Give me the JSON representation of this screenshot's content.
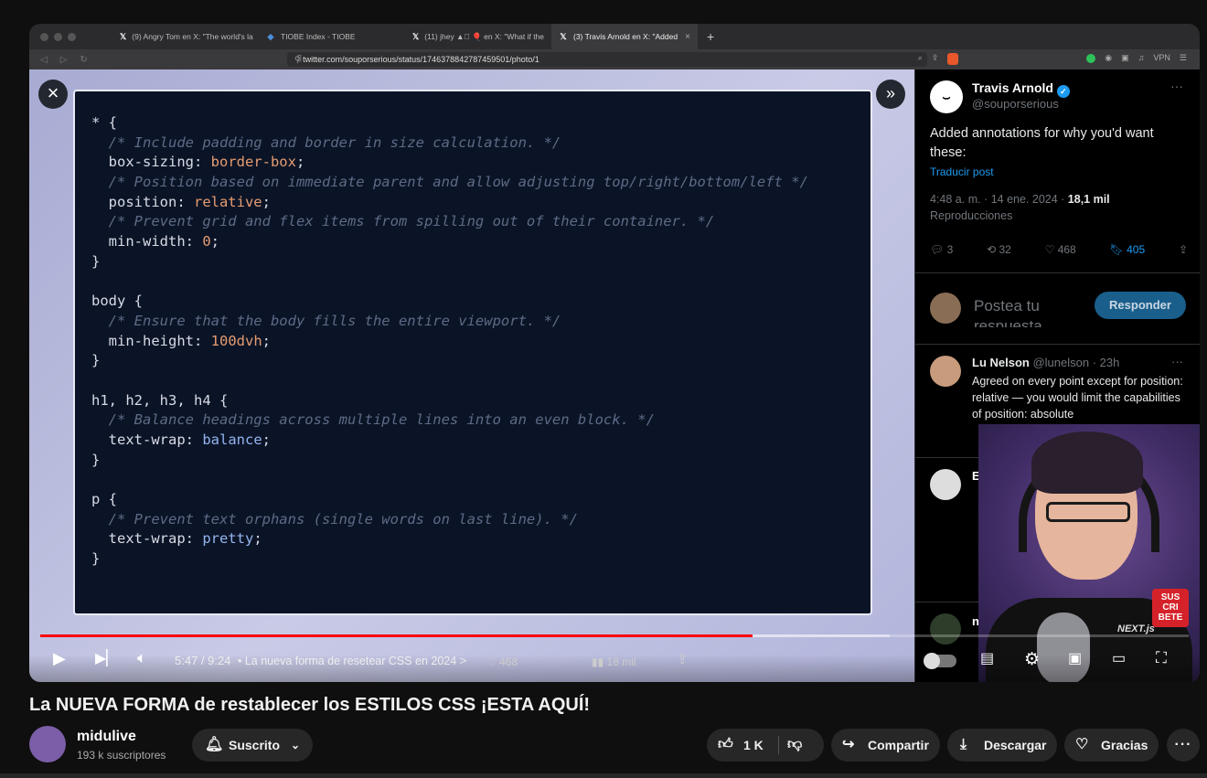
{
  "browser": {
    "tabs": [
      {
        "label": "(9) Angry Tom en X: \"The world's la",
        "icon": "x-logo"
      },
      {
        "label": "TIOBE Index - TIOBE",
        "icon": "tiobe-logo"
      },
      {
        "label": "(11) jhey ▲🏽 🎈 en X: \"What if the",
        "icon": "x-logo"
      },
      {
        "label": "(3) Travis Arnold en X: \"Added",
        "icon": "x-logo"
      }
    ],
    "url": "twitter.com/souporserious/status/1746378842787459501/photo/1",
    "vpn_label": "VPN"
  },
  "code_lines": [
    [
      {
        "t": "* {",
        "c": ""
      }
    ],
    [
      {
        "t": "  /* Include padding and border in size calculation. */",
        "c": "cm"
      }
    ],
    [
      {
        "t": "  box-sizing: ",
        "c": ""
      },
      {
        "t": "border-box",
        "c": "vl"
      },
      {
        "t": ";",
        "c": ""
      }
    ],
    [
      {
        "t": "  /* Position based on immediate parent and allow adjusting top/right/bottom/left */",
        "c": "cm"
      }
    ],
    [
      {
        "t": "  position: ",
        "c": ""
      },
      {
        "t": "relative",
        "c": "vl"
      },
      {
        "t": ";",
        "c": ""
      }
    ],
    [
      {
        "t": "  /* Prevent grid and flex items from spilling out of their container. */",
        "c": "cm"
      }
    ],
    [
      {
        "t": "  min-width: ",
        "c": ""
      },
      {
        "t": "0",
        "c": "vl"
      },
      {
        "t": ";",
        "c": ""
      }
    ],
    [
      {
        "t": "}",
        "c": ""
      }
    ],
    [
      {
        "t": "",
        "c": ""
      }
    ],
    [
      {
        "t": "body {",
        "c": ""
      }
    ],
    [
      {
        "t": "  /* Ensure that the body fills the entire viewport. */",
        "c": "cm"
      }
    ],
    [
      {
        "t": "  min-height: ",
        "c": ""
      },
      {
        "t": "100dvh",
        "c": "vl"
      },
      {
        "t": ";",
        "c": ""
      }
    ],
    [
      {
        "t": "}",
        "c": ""
      }
    ],
    [
      {
        "t": "",
        "c": ""
      }
    ],
    [
      {
        "t": "h1, h2, h3, h4 {",
        "c": ""
      }
    ],
    [
      {
        "t": "  /* Balance headings across multiple lines into an even block. */",
        "c": "cm"
      }
    ],
    [
      {
        "t": "  text-wrap: ",
        "c": ""
      },
      {
        "t": "balance",
        "c": "kw"
      },
      {
        "t": ";",
        "c": ""
      }
    ],
    [
      {
        "t": "}",
        "c": ""
      }
    ],
    [
      {
        "t": "",
        "c": ""
      }
    ],
    [
      {
        "t": "p {",
        "c": ""
      }
    ],
    [
      {
        "t": "  /* Prevent text orphans (single words on last line). */",
        "c": "cm"
      }
    ],
    [
      {
        "t": "  text-wrap: ",
        "c": ""
      },
      {
        "t": "pretty",
        "c": "kw"
      },
      {
        "t": ";",
        "c": ""
      }
    ],
    [
      {
        "t": "}",
        "c": ""
      }
    ]
  ],
  "tweet": {
    "author_name": "Travis Arnold",
    "author_handle": "@souporserious",
    "text": "Added annotations for why you'd want these:",
    "translate": "Traducir post",
    "meta_time": "4:48 a. m. · 14 ene. 2024 · ",
    "meta_views": "18,1 mil",
    "meta_views_label": "Reproducciones",
    "replies": "3",
    "retweets": "32",
    "likes": "468",
    "bookmarks": "405",
    "reply_placeholder": "Postea tu respuesta",
    "reply_button": "Responder"
  },
  "comments": [
    {
      "name": "Lu Nelson",
      "handle": "@lunelson · 23h",
      "text": "Agreed on every point except for position: relative — you would limit the capabilities of position: absolute"
    },
    {
      "name": "E",
      "handle": "",
      "text": ""
    },
    {
      "name": "n",
      "handle": "",
      "text": ""
    }
  ],
  "webcam": {
    "badge": "SUS CRI BETE",
    "logo": "NEXT.js"
  },
  "player": {
    "time": "5:47 / 9:24",
    "chapter": "• La nueva forma de resetear CSS en 2024 >",
    "bg_likes": "468",
    "bg_views": "18 mil",
    "progress_played": 0.62,
    "progress_buffered": 0.74
  },
  "video": {
    "title": "La NUEVA FORMA de restablecer los ESTILOS CSS ¡ESTA AQUÍ!",
    "channel": "midulive",
    "subscribers": "193 k suscriptores",
    "subscribed_label": "Suscrito",
    "likes": "1 K",
    "share_label": "Compartir",
    "download_label": "Descargar",
    "thanks_label": "Gracias"
  },
  "colors": {
    "youtube_red": "#ff0000",
    "x_blue": "#1d9bf0"
  }
}
